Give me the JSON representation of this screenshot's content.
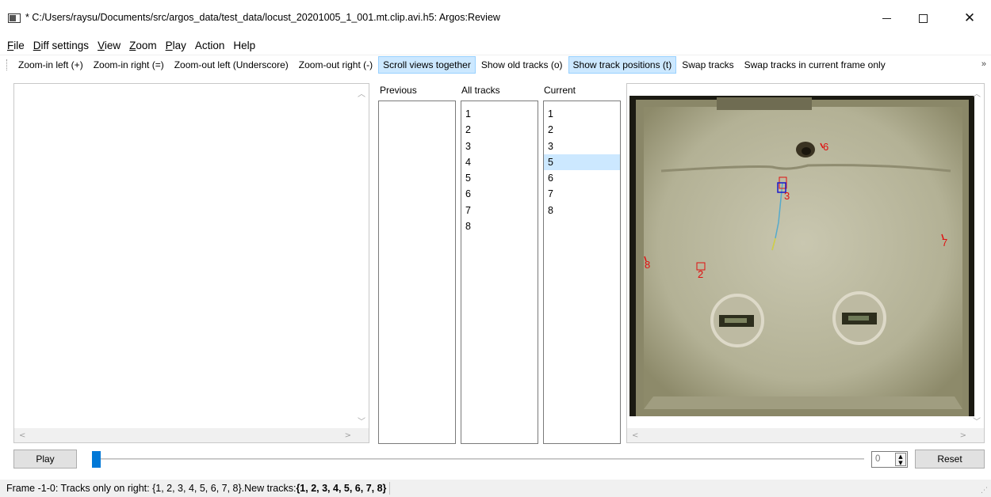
{
  "window": {
    "title": "* C:/Users/raysu/Documents/src/argos_data/test_data/locust_20201005_1_001.mt.clip.avi.h5: Argos:Review",
    "close_glyph": "✕"
  },
  "menu": {
    "file": {
      "mnemonic": "F",
      "rest": "ile"
    },
    "diff": {
      "mnemonic": "D",
      "rest": "iff settings"
    },
    "view": {
      "mnemonic": "V",
      "rest": "iew"
    },
    "zoom": {
      "mnemonic": "Z",
      "rest": "oom"
    },
    "play": {
      "mnemonic": "P",
      "rest": "lay"
    },
    "action": "Action",
    "help": "Help"
  },
  "toolbar": {
    "zoom_in_left": "Zoom-in left (+)",
    "zoom_in_right": "Zoom-in right (=)",
    "zoom_out_left": "Zoom-out left (Underscore)",
    "zoom_out_right": "Zoom-out right (-)",
    "scroll_together": "Scroll views together",
    "show_old_tracks": "Show old tracks (o)",
    "show_track_positions": "Show track positions (t)",
    "swap_tracks": "Swap tracks",
    "swap_current": "Swap tracks in current frame only",
    "more": "»"
  },
  "lists": {
    "previous": {
      "header": "Previous",
      "items": []
    },
    "all_tracks": {
      "header": "All tracks",
      "items": [
        "1",
        "2",
        "3",
        "4",
        "5",
        "6",
        "7",
        "8"
      ]
    },
    "current": {
      "header": "Current",
      "items": [
        "1",
        "2",
        "3",
        "5",
        "6",
        "7",
        "8"
      ],
      "selected": "5"
    }
  },
  "video_labels": {
    "l6": "6",
    "l3": "3",
    "l7": "7",
    "l8": "8",
    "l2": "2"
  },
  "controls": {
    "play": "Play",
    "frame_value": "0",
    "reset": "Reset",
    "slider_progress": 0
  },
  "status": {
    "prefix": "Frame -1-0: Tracks only on right: {1, 2, 3, 4, 5, 6, 7, 8}.New tracks: ",
    "new_tracks": "{1, 2, 3, 4, 5, 6, 7, 8}"
  },
  "colors": {
    "selection": "#cce8ff",
    "slider_handle": "#0078d7",
    "track_label": "#e01010",
    "track_label_active": "#1a1acc"
  }
}
